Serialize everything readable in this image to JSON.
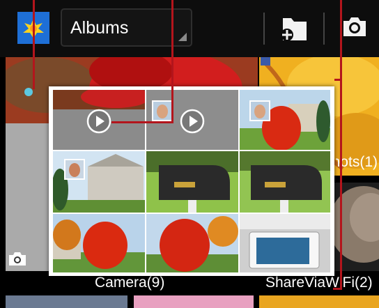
{
  "actionbar": {
    "album_spinner_label": "Albums",
    "new_album_icon": "new-folder-icon",
    "camera_icon": "camera-icon"
  },
  "albums": [
    {
      "name": "Camera(9)"
    },
    {
      "name": "ShareViaWiFi(2)"
    },
    {
      "name": "Screenshots(1)"
    }
  ],
  "colors": {
    "callout_line": "#b3151c",
    "actionbar_bg": "#0d0d0d",
    "popup_border": "#ffffff"
  }
}
